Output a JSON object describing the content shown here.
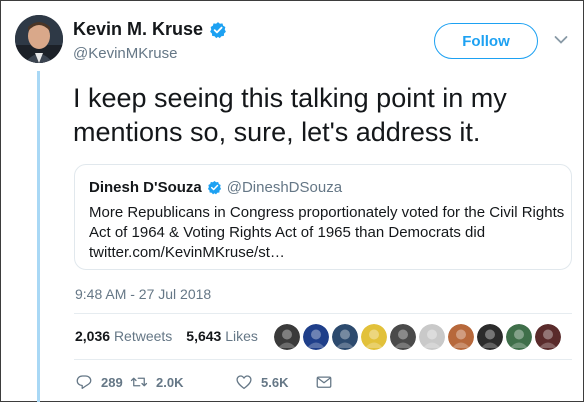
{
  "tweet": {
    "author_name": "Kevin M. Kruse",
    "author_handle": "@KevinMKruse",
    "follow_label": "Follow",
    "text": "I keep seeing this talking point in my mentions so, sure, let's address it.",
    "timestamp": "9:48 AM - 27 Jul 2018"
  },
  "quoted": {
    "author_name": "Dinesh D'Souza",
    "author_handle": "@DineshDSouza",
    "text": "More Republicans in Congress proportionately voted for the Civil Rights Act of 1964 & Voting Rights Act of 1965 than Democrats did",
    "link": "twitter.com/KevinMKruse/st…"
  },
  "stats": {
    "retweets_count": "2,036",
    "retweets_label": "Retweets",
    "likes_count": "5,643",
    "likes_label": "Likes"
  },
  "likers": [
    {
      "icon": "liker-avatar-1",
      "color": "#3a3a3a"
    },
    {
      "icon": "liker-avatar-2",
      "color": "#1f3f8a"
    },
    {
      "icon": "liker-avatar-3",
      "color": "#2c4a6e"
    },
    {
      "icon": "liker-avatar-4",
      "color": "#e2c13a"
    },
    {
      "icon": "liker-avatar-5",
      "color": "#4a4a4a"
    },
    {
      "icon": "liker-avatar-6",
      "color": "#c9c9c9"
    },
    {
      "icon": "liker-avatar-7",
      "color": "#b7683b"
    },
    {
      "icon": "liker-avatar-8",
      "color": "#2b2b2b"
    },
    {
      "icon": "liker-avatar-9",
      "color": "#3f6f4a"
    },
    {
      "icon": "liker-avatar-10",
      "color": "#5a2b2b"
    }
  ],
  "actions": {
    "replies": "289",
    "retweets": "2.0K",
    "likes": "5.6K"
  },
  "colors": {
    "accent": "#1da1f2",
    "thread_line": "#a9d8f5",
    "secondary_text": "#657786"
  }
}
